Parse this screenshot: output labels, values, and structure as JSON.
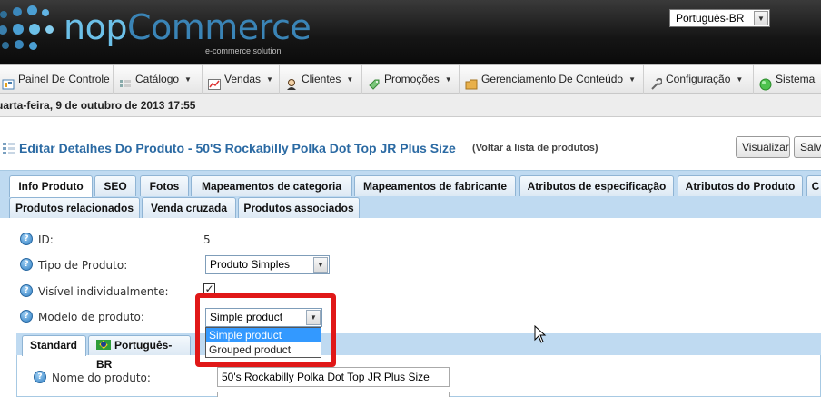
{
  "brand": {
    "name_part1": "nop",
    "name_part2": "Commerce",
    "tagline": "e-commerce solution"
  },
  "language_selector": {
    "value": "Português-BR"
  },
  "menu": [
    {
      "label": "Painel De Controle",
      "icon": "dashboard-icon"
    },
    {
      "label": "Catálogo",
      "icon": "catalog-icon"
    },
    {
      "label": "Vendas",
      "icon": "sales-chart-icon"
    },
    {
      "label": "Clientes",
      "icon": "customer-icon"
    },
    {
      "label": "Promoções",
      "icon": "promotion-tag-icon"
    },
    {
      "label": "Gerenciamento De Conteúdo",
      "icon": "folder-icon"
    },
    {
      "label": "Configuração",
      "icon": "wrench-icon"
    },
    {
      "label": "Sistema",
      "icon": "green-status-icon"
    }
  ],
  "date_text": "uarta-feira, 9 de outubro de 2013 17:55",
  "page": {
    "title": "Editar Detalhes Do Produto - 50'S Rockabilly Polka Dot Top JR Plus Size",
    "back_link": "(Voltar à lista de produtos)",
    "view_button": "Visualizar",
    "save_button": "Salv"
  },
  "tabs_row1": [
    "Info Produto",
    "SEO",
    "Fotos",
    "Mapeamentos de categoria",
    "Mapeamentos de fabricante",
    "Atributos de especificação",
    "Atributos do Produto",
    "C"
  ],
  "tabs_row2": [
    "Produtos relacionados",
    "Venda cruzada",
    "Produtos associados"
  ],
  "fields": {
    "id_label": "ID:",
    "id_value": "5",
    "product_type_label": "Tipo de Produto:",
    "product_type_value": "Produto Simples",
    "visible_label": "Visível individualmente:",
    "visible_checked": "✓",
    "template_label": "Modelo de produto:",
    "template_value": "Simple product",
    "template_options": [
      "Simple product",
      "Grouped product"
    ]
  },
  "inner_tabs": [
    "Standard",
    "Português-BR"
  ],
  "name_field": {
    "label": "Nome do produto:",
    "value": "50's Rockabilly Polka Dot Top JR Plus Size"
  },
  "colors": {
    "title_blue": "#2b6aa3",
    "tab_strip": "#bfdaf1",
    "highlight_red": "#e01818",
    "selection_blue": "#3399ff"
  }
}
